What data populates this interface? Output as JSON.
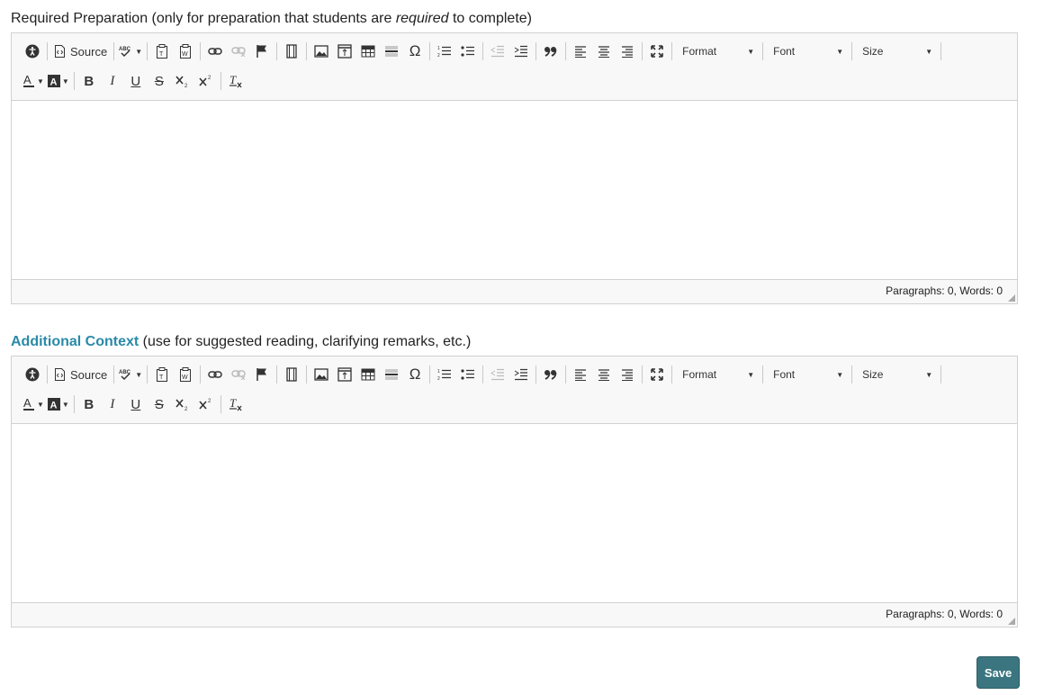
{
  "field1": {
    "label_before": "Required Preparation (only for preparation that students are ",
    "label_em": "required",
    "label_after": " to complete)",
    "status": "Paragraphs: 0, Words: 0"
  },
  "field2": {
    "label_accent": "Additional Context",
    "label_rest": " (use for suggested reading, clarifying remarks, etc.)",
    "status": "Paragraphs: 0, Words: 0"
  },
  "toolbar": {
    "source_label": "Source",
    "format_label": "Format",
    "font_label": "Font",
    "size_label": "Size",
    "omega": "Ω",
    "bold": "B",
    "italic": "I",
    "underline": "U",
    "strike": "S"
  },
  "icons": [
    "accessibility-icon",
    "source-icon",
    "spellcheck-icon",
    "paste-text-icon",
    "paste-word-icon",
    "link-icon",
    "unlink-icon",
    "anchor-icon",
    "video-icon",
    "image-icon",
    "template-icon",
    "table-icon",
    "horizontal-rule-icon",
    "special-char-icon",
    "numbered-list-icon",
    "bulleted-list-icon",
    "outdent-icon",
    "indent-icon",
    "blockquote-icon",
    "align-left-icon",
    "align-center-icon",
    "align-right-icon",
    "maximize-icon",
    "text-color-icon",
    "background-color-icon",
    "subscript-icon",
    "superscript-icon",
    "remove-format-icon"
  ],
  "colors": {
    "accent": "#2a8aa8",
    "save_button": "#3b7680",
    "toolbar_bg": "#f8f8f8"
  },
  "save_label": "Save"
}
